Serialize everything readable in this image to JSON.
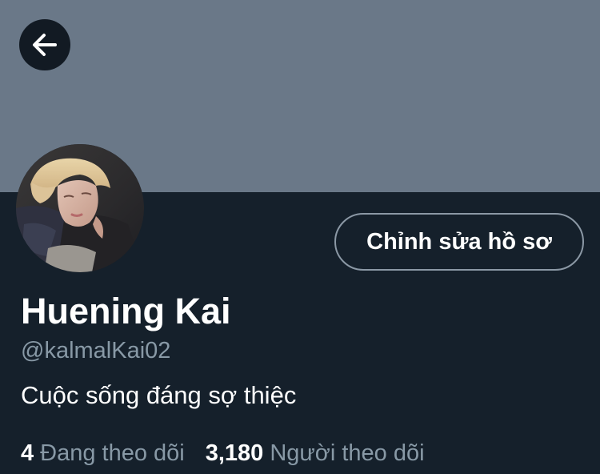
{
  "header": {
    "back_icon": "arrow-left-icon",
    "banner_color": "#6a7888"
  },
  "profile": {
    "display_name": "Huening Kai",
    "handle": "@kalmalKai02",
    "bio": "Cuộc sống đáng sợ thiệc",
    "edit_button_label": "Chỉnh sửa hồ sơ"
  },
  "stats": {
    "following_count": "4",
    "following_label": "Đang theo dõi",
    "followers_count": "3,180",
    "followers_label": "Người theo dõi"
  },
  "colors": {
    "background": "#15202b",
    "secondary_text": "#8899a6",
    "button_border": "#8b98a5"
  }
}
